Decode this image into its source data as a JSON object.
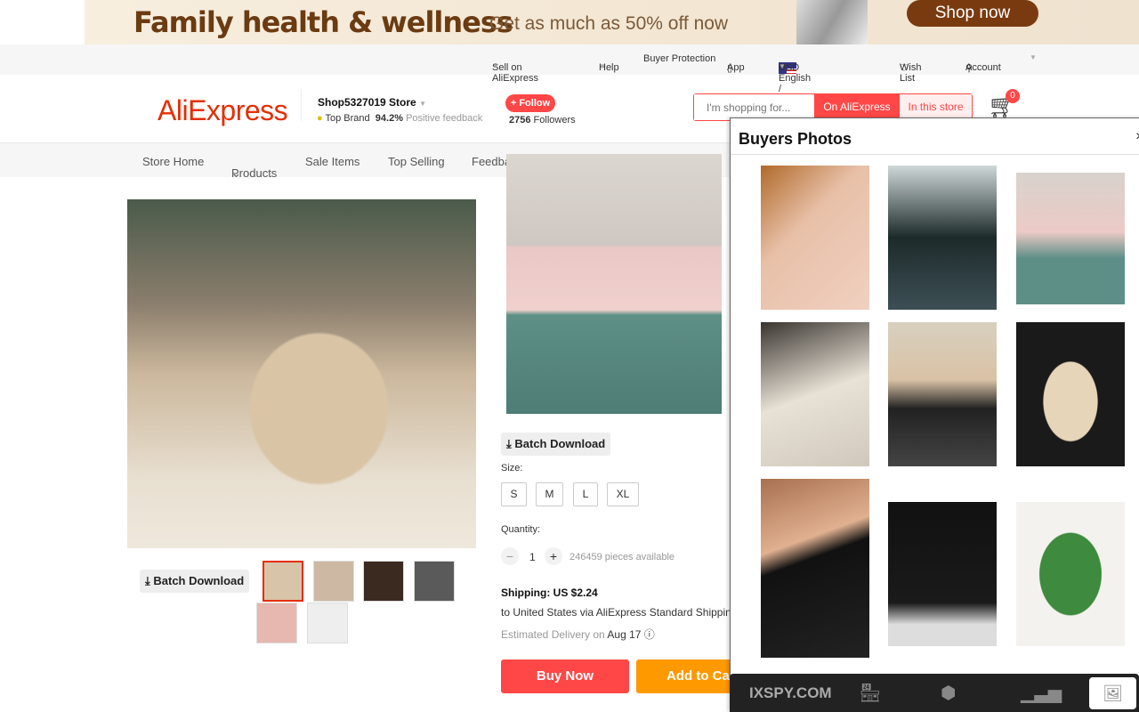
{
  "banner": {
    "title": "Family health & wellness",
    "subtitle": "Get as much as 50% off now",
    "cta": "Shop now"
  },
  "topnav": {
    "sell": "Sell on AliExpress",
    "help": "Help",
    "protection": "Buyer Protection",
    "app": "App",
    "lang": "/ English /",
    "currency": "USD",
    "wishlist": "Wish List",
    "account": "Account"
  },
  "header": {
    "logo": "AliExpress",
    "store_name": "Shop5327019 Store",
    "top_brand": "Top Brand",
    "feedback_pct": "94.2%",
    "feedback_label": "Positive feedback",
    "follow": "+ Follow",
    "followers_count": "2756",
    "followers_label": "Followers",
    "search_placeholder": "I'm shopping for...",
    "search_all": "On AliExpress",
    "search_store": "In this store",
    "cart_count": "0"
  },
  "storenav": [
    "Store Home",
    "Products",
    "Sale Items",
    "Top Selling",
    "Feedback"
  ],
  "product": {
    "batch_download": "Batch Download",
    "size_label": "Size:",
    "sizes": [
      "S",
      "M",
      "L",
      "XL"
    ],
    "quantity_label": "Quantity:",
    "quantity": "1",
    "available": "246459 pieces available",
    "shipping": "Shipping: US $2.24",
    "shipping_via": "to United States via AliExpress Standard Shipping",
    "delivery_label": "Estimated Delivery on",
    "delivery_date": "Aug 17",
    "buy_now": "Buy Now",
    "add_to_cart": "Add to Cart"
  },
  "panel": {
    "title": "Buyers Photos",
    "brand": "IXSPY.COM",
    "tabs": [
      "store-icon",
      "product-icon",
      "chart-icon",
      "image-icon"
    ]
  },
  "colors": {
    "accent": "#ff4747",
    "logo": "#e62e04",
    "orange": "#ff9900"
  }
}
